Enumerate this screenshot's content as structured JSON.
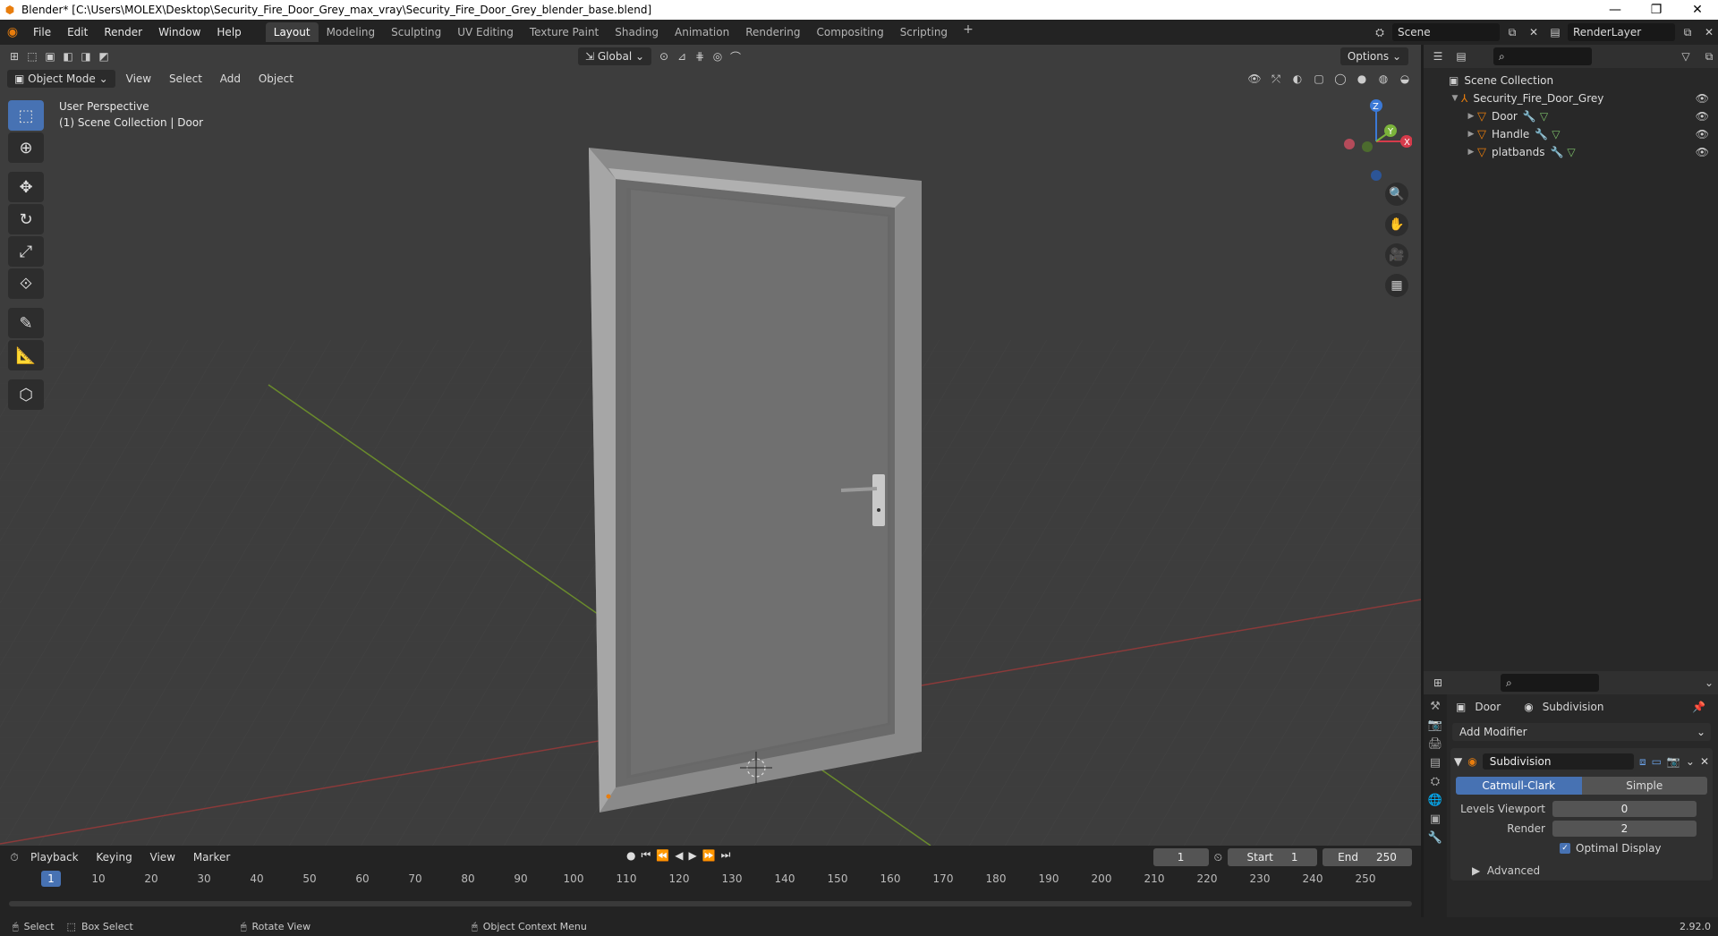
{
  "titlebar": {
    "title": "Blender* [C:\\Users\\MOLEX\\Desktop\\Security_Fire_Door_Grey_max_vray\\Security_Fire_Door_Grey_blender_base.blend]",
    "minimize": "—",
    "restore": "❐",
    "close": "✕"
  },
  "menu": [
    "File",
    "Edit",
    "Render",
    "Window",
    "Help"
  ],
  "workspaces": [
    {
      "label": "Layout",
      "active": true
    },
    {
      "label": "Modeling"
    },
    {
      "label": "Sculpting"
    },
    {
      "label": "UV Editing"
    },
    {
      "label": "Texture Paint"
    },
    {
      "label": "Shading"
    },
    {
      "label": "Animation"
    },
    {
      "label": "Rendering"
    },
    {
      "label": "Compositing"
    },
    {
      "label": "Scripting"
    }
  ],
  "scene": {
    "name": "Scene",
    "render_layer": "RenderLayer"
  },
  "viewport": {
    "transform_orientation": "Global",
    "options_label": "Options",
    "mode": "Object Mode",
    "header_menu": [
      "View",
      "Select",
      "Add",
      "Object"
    ],
    "perspective_label": "User Perspective",
    "collection_label": "(1) Scene Collection | Door",
    "gizmo": {
      "x": "X",
      "y": "Y",
      "z": "Z"
    }
  },
  "outliner": {
    "root": "Scene Collection",
    "collection": "Security_Fire_Door_Grey",
    "objects": [
      "Door",
      "Handle",
      "platbands"
    ]
  },
  "properties": {
    "object": "Door",
    "modifier_context": "Subdivision",
    "add_modifier": "Add Modifier",
    "modifier_name": "Subdivision",
    "mode_catmull": "Catmull-Clark",
    "mode_simple": "Simple",
    "levels_viewport_label": "Levels Viewport",
    "levels_viewport": "0",
    "render_label": "Render",
    "render_value": "2",
    "optimal_display": "Optimal Display",
    "advanced": "Advanced"
  },
  "timeline": {
    "menus": [
      "Playback",
      "Keying",
      "View",
      "Marker"
    ],
    "current_frame": "1",
    "start_label": "Start",
    "start": "1",
    "end_label": "End",
    "end": "250",
    "ruler": [
      "10",
      "20",
      "30",
      "40",
      "50",
      "60",
      "70",
      "80",
      "90",
      "100",
      "110",
      "120",
      "130",
      "140",
      "150",
      "160",
      "170",
      "180",
      "190",
      "200",
      "210",
      "220",
      "230",
      "240",
      "250"
    ],
    "cursor_label": "1"
  },
  "statusbar": {
    "select": "Select",
    "box_select": "Box Select",
    "rotate_view": "Rotate View",
    "context_menu": "Object Context Menu",
    "version": "2.92.0"
  }
}
